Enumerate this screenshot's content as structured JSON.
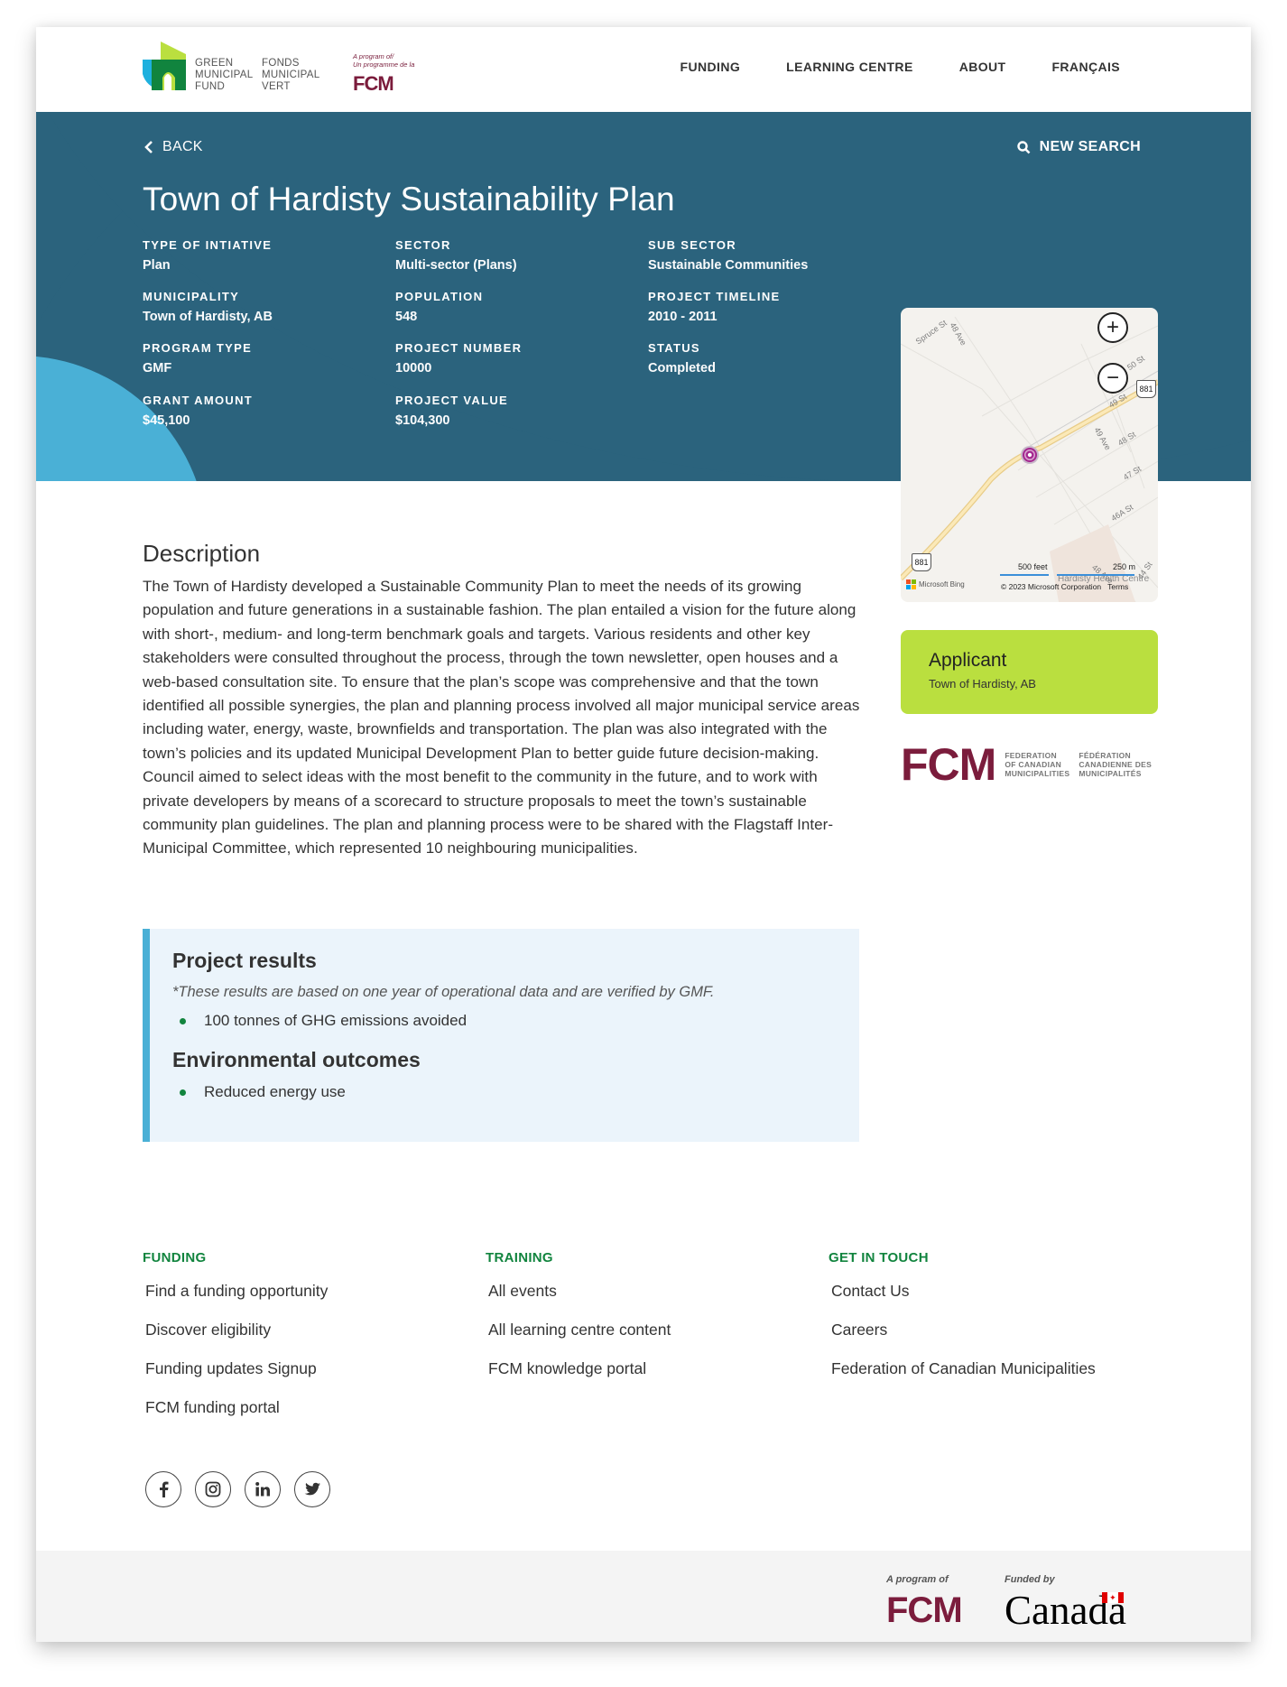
{
  "brand": {
    "logo_en": [
      "GREEN",
      "MUNICIPAL",
      "FUND"
    ],
    "logo_fr": [
      "FONDS",
      "MUNICIPAL",
      "VERT"
    ],
    "program_of": [
      "A program of/",
      "Un programme de la"
    ],
    "fcm": "FCM",
    "colors": {
      "navy": "#2b637d",
      "lime": "#badf3f",
      "sky": "#4ab0d6",
      "green": "#11843e",
      "fcm_maroon": "#7b1c3c"
    }
  },
  "nav": {
    "links": [
      {
        "label": "FUNDING"
      },
      {
        "label": "LEARNING CENTRE"
      },
      {
        "label": "ABOUT"
      },
      {
        "label": "FRANÇAIS"
      }
    ]
  },
  "hero": {
    "back_label": "BACK",
    "back_icon": "chevron-left-icon",
    "new_search_label": "NEW SEARCH",
    "new_search_icon": "search-icon",
    "title": "Town of Hardisty Sustainability Plan",
    "info": [
      {
        "label": "TYPE OF INTIATIVE",
        "value": "Plan"
      },
      {
        "label": "SECTOR",
        "value": "Multi-sector (Plans)"
      },
      {
        "label": "SUB SECTOR",
        "value": "Sustainable Communities"
      },
      {
        "label": "MUNICIPALITY",
        "value": "Town of Hardisty, AB"
      },
      {
        "label": "POPULATION",
        "value": "548"
      },
      {
        "label": "PROJECT TIMELINE",
        "value": "2010 - 2011"
      },
      {
        "label": "PROGRAM TYPE",
        "value": "GMF"
      },
      {
        "label": "PROJECT NUMBER",
        "value": "10000"
      },
      {
        "label": "STATUS",
        "value": "Completed"
      },
      {
        "label": "GRANT AMOUNT",
        "value": "$45,100"
      },
      {
        "label": "PROJECT VALUE",
        "value": "$104,300"
      }
    ]
  },
  "map": {
    "zoom_in": "+",
    "zoom_out": "−",
    "streets": [
      "Spruce St",
      "48 Ave",
      "50 St",
      "49 St",
      "49 Ave",
      "48 St",
      "47 St",
      "46A St",
      "48 Ave",
      "44 St",
      "48 Ave"
    ],
    "highway": "881",
    "scale_feet": "500 feet",
    "scale_m": "250 m",
    "provider": "Microsoft Bing",
    "copyright": "© 2023 Microsoft Corporation",
    "terms": "Terms",
    "poi": "Hardisty Health Centre"
  },
  "applicant": {
    "title": "Applicant",
    "name": "Town of Hardisty, AB"
  },
  "fcm_full": {
    "en": [
      "FEDERATION",
      "OF CANADIAN",
      "MUNICIPALITIES"
    ],
    "fr": [
      "FÉDÉRATION",
      "CANADIENNE DES",
      "MUNICIPALITÉS"
    ]
  },
  "description": {
    "title": "Description",
    "body": "The Town of Hardisty developed a Sustainable Community Plan to meet the needs of its growing population and future generations in a sustainable fashion. The plan entailed a vision for the future along with short-, medium- and long-term benchmark goals and targets. Various residents and other key stakeholders were consulted throughout the process, through the town newsletter, open houses and a web-based consultation site. To ensure that the plan’s scope was comprehensive and that the town identified all possible synergies, the plan and planning process involved all major municipal service areas including water, energy, waste, brownfields and transportation. The plan was also integrated with the town’s policies and its updated Municipal Development Plan to better guide future decision-making. Council aimed to select ideas with the most benefit to the community in the future, and to work with private developers by means of a scorecard to structure proposals to meet the town’s sustainable community plan guidelines. The plan and planning process were to be shared with the Flagstaff Inter-Municipal Committee, which represented 10 neighbouring municipalities."
  },
  "results": {
    "title": "Project results",
    "note": "*These results are based on one year of operational data and are verified by GMF.",
    "items": [
      "100 tonnes of GHG emissions avoided"
    ],
    "env_title": "Environmental outcomes",
    "env_items": [
      "Reduced energy use"
    ]
  },
  "footer": {
    "columns": [
      {
        "heading": "FUNDING",
        "links": [
          "Find a funding opportunity",
          "Discover eligibility",
          "Funding updates Signup",
          "FCM funding portal"
        ]
      },
      {
        "heading": "TRAINING",
        "links": [
          "All events",
          "All learning centre content",
          "FCM knowledge portal"
        ]
      },
      {
        "heading": "GET IN TOUCH",
        "links": [
          "Contact Us",
          "Careers",
          "Federation of Canadian Municipalities"
        ]
      }
    ],
    "socials": [
      "facebook-icon",
      "instagram-icon",
      "linkedin-icon",
      "twitter-icon"
    ],
    "program_of": "A program of",
    "funded_by": "Funded by",
    "canada": "Canada"
  }
}
